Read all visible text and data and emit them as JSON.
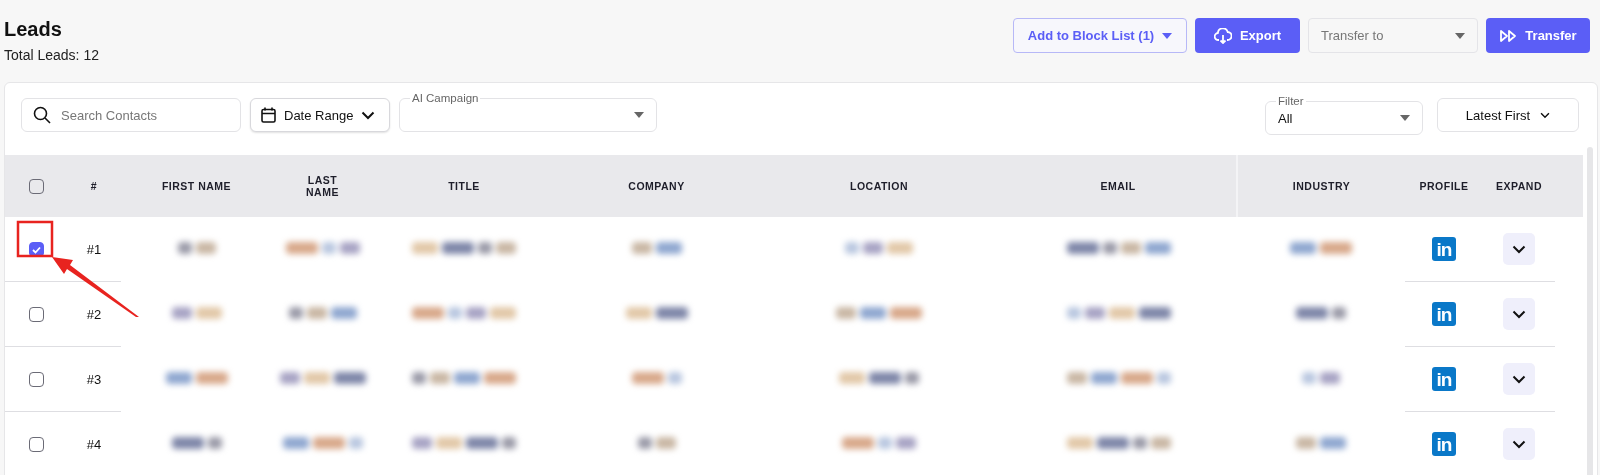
{
  "page": {
    "title": "Leads",
    "total": "Total Leads: 12"
  },
  "actions": [
    {
      "kind": "dropdown-button",
      "label": "Add to Block List (1)"
    },
    {
      "kind": "export-button",
      "label": "Export"
    },
    {
      "kind": "select",
      "placeholder": "Transfer to"
    },
    {
      "kind": "transfer-button",
      "label": "Transfer"
    }
  ],
  "filters": {
    "search": {
      "placeholder": "Search Contacts"
    },
    "date_range": {
      "label": "Date Range"
    },
    "ai_campaign": {
      "label": "AI Campaign"
    },
    "filter": {
      "label": "Filter",
      "value": "All"
    },
    "sort": {
      "label": "Latest First"
    }
  },
  "table": {
    "all_checked": false,
    "columns": [
      "#",
      "FIRST NAME",
      "LAST NAME",
      "TITLE",
      "COMPANY",
      "LOCATION",
      "EMAIL",
      "INDUSTRY",
      "PROFILE",
      "EXPAND"
    ],
    "rows": [
      {
        "selected": true,
        "number": "#1",
        "redacted": true,
        "profile": "in"
      },
      {
        "selected": false,
        "number": "#2",
        "redacted": true,
        "profile": "in"
      },
      {
        "selected": false,
        "number": "#3",
        "redacted": true,
        "profile": "in"
      },
      {
        "selected": false,
        "number": "#4",
        "redacted": true,
        "profile": "in"
      }
    ]
  },
  "annotation": {
    "kind": "callout"
  }
}
